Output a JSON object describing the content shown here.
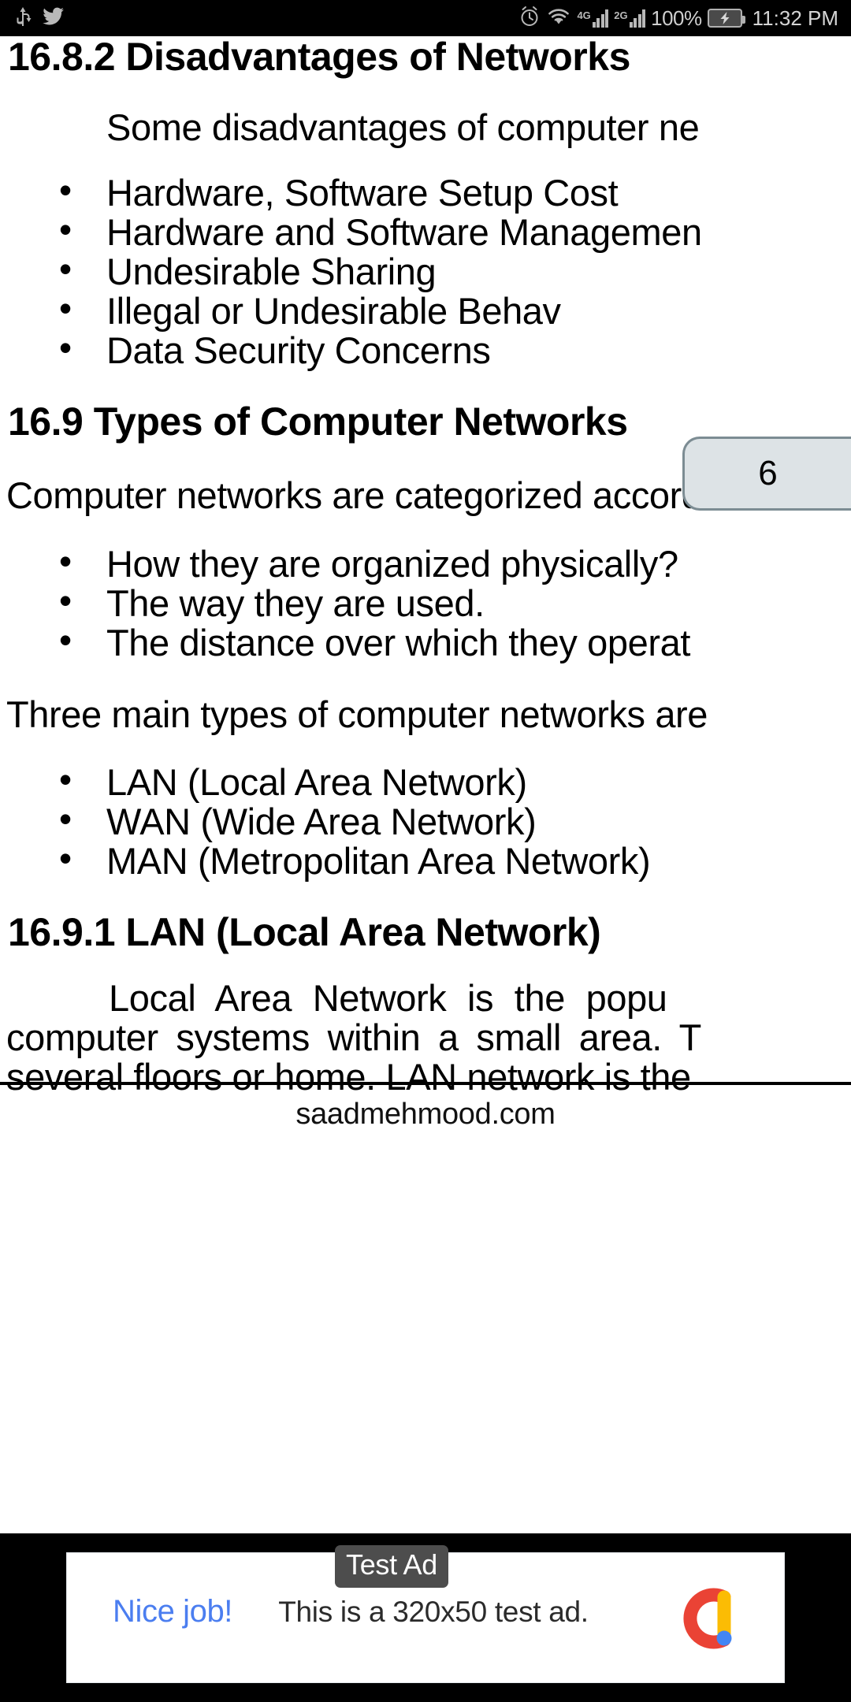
{
  "statusbar": {
    "left_icons": [
      "usb-icon",
      "twitter-icon"
    ],
    "right_icons": [
      "alarm-icon",
      "wifi-icon",
      "signal-4g-icon",
      "signal-2g-icon",
      "battery-charging-icon"
    ],
    "network_1_label": "4G",
    "network_2_label": "2G",
    "battery_percent": "100%",
    "time": "11:32 PM"
  },
  "document": {
    "heading_1": "16.8.2 Disadvantages of Networks",
    "intro_1": "Some disadvantages of computer ne",
    "disadvantages": [
      "Hardware, Software Setup Cost",
      "Hardware and Software Managemen",
      "Undesirable Sharing",
      "Illegal or Undesirable Behav",
      "Data Security Concerns"
    ],
    "heading_2": "16.9 Types of Computer Networks",
    "intro_2": "Computer networks are categorized accord",
    "criteria": [
      "How they are organized physically?",
      "The way they are used.",
      "The distance over which they operat"
    ],
    "intro_3": "Three main types of computer networks are",
    "types": [
      "LAN (Local Area Network)",
      "WAN (Wide Area Network)",
      "MAN (Metropolitan Area Network)"
    ],
    "heading_3": "16.9.1 LAN (Local Area Network)",
    "lan_paragraph_lines": [
      "Local Area Network is the popu",
      "computer systems within a small area. T",
      "several floors or home. LAN network is the"
    ],
    "page_number": "6",
    "footer_site": "saadmehmood.com"
  },
  "ad": {
    "label": "Test Ad",
    "headline": "Nice job!",
    "body": "This is a 320x50 test ad.",
    "logo_name": "admob-logo",
    "link_color": "#4b7ef0",
    "label_bg": "#4d4d4d"
  }
}
